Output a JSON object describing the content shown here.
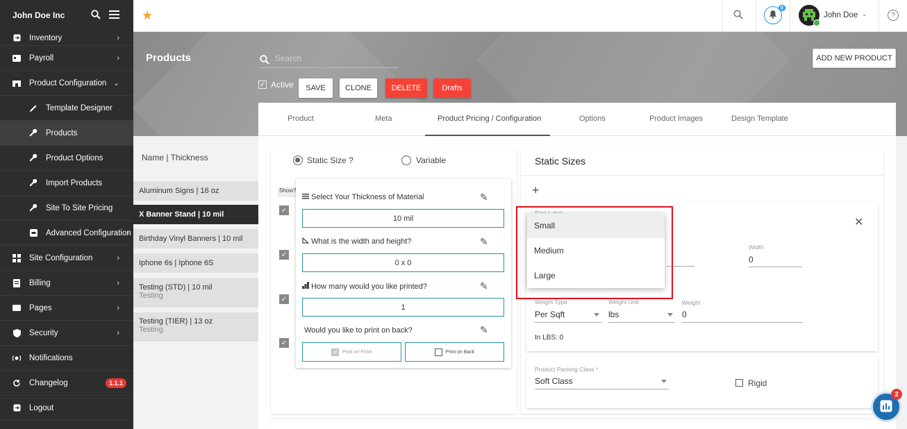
{
  "brand": "John Doe Inc",
  "topbar": {
    "notification_count": "0",
    "user_name": "John Doe"
  },
  "sidebar": {
    "items": [
      {
        "label": "Inventory"
      },
      {
        "label": "Payroll"
      },
      {
        "label": "Product Configuration"
      },
      {
        "label": "Template Designer"
      },
      {
        "label": "Products"
      },
      {
        "label": "Product Options"
      },
      {
        "label": "Import Products"
      },
      {
        "label": "Site To Site Pricing"
      },
      {
        "label": "Advanced Configuration"
      },
      {
        "label": "Site Configuration"
      },
      {
        "label": "Billing"
      },
      {
        "label": "Pages"
      },
      {
        "label": "Security"
      },
      {
        "label": "Notifications"
      },
      {
        "label": "Changelog",
        "badge": "1.1.1"
      },
      {
        "label": "Logout"
      }
    ]
  },
  "header": {
    "title": "Products",
    "search_placeholder": "Search",
    "add_new": "ADD NEW PRODUCT",
    "active_label": "Active",
    "buttons": {
      "save": "SAVE",
      "clone": "CLONE",
      "delete": "DELETE",
      "drafts": "Drafts"
    }
  },
  "product_list": {
    "header": "Name | Thickness",
    "items": [
      {
        "name": "Aluminum Signs | 16 oz",
        "sub": ""
      },
      {
        "name": "X Banner Stand | 10 mil",
        "sub": ""
      },
      {
        "name": "Birthday Vinyl Banners | 10 mil",
        "sub": ""
      },
      {
        "name": "Iphone 6s | Iphone 6S",
        "sub": ""
      },
      {
        "name": "Testing (STD) | 10 mil",
        "sub": "Testing"
      },
      {
        "name": "Testing (TIER) | 13 oz",
        "sub": "Testing"
      }
    ]
  },
  "tabs": [
    "Product",
    "Meta",
    "Product Pricing / Configuration",
    "Options",
    "Product Images",
    "Design Template"
  ],
  "config": {
    "static_size_label": "Static Size ?",
    "variable_label": "Variable",
    "show_label": "Show?",
    "questions": [
      {
        "label": "Select Your Thickness of Material",
        "value": "10 mil"
      },
      {
        "label": "What is the width and height?",
        "value": "0 x 0"
      },
      {
        "label": "How many would you like printed?",
        "value": "1"
      },
      {
        "label": "Would you like to print on back?",
        "value": ""
      }
    ],
    "print_front": "Print on Front",
    "print_back": "Print on Back"
  },
  "static_sizes": {
    "title": "Static Sizes",
    "size_label_caption": "Size Label",
    "width_label": "Width",
    "width_value": "0",
    "weight_type_label": "Weight Type",
    "weight_type_value": "Per Sqft",
    "weight_unit_label": "Weight Unit",
    "weight_unit_value": "lbs",
    "weight_label": "Weight",
    "weight_value": "0",
    "in_lbs": "In LBS: 0",
    "packing_label": "Product Packing Class *",
    "packing_value": "Soft Class",
    "rigid_label": "Rigid",
    "dropdown_options": [
      "Small",
      "Medium",
      "Large"
    ]
  },
  "chat_badge": "2"
}
